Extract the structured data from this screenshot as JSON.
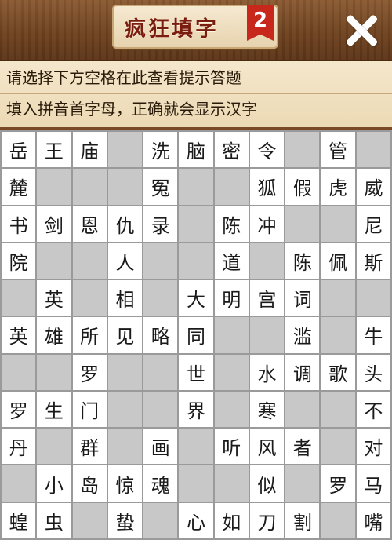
{
  "header": {
    "title": "疯狂填字",
    "badge": "2",
    "close_icon": "close-x-icon"
  },
  "hints": {
    "line1": "请选择下方空格在此查看提示答题",
    "line2": "填入拼音首字母，正确就会显示汉字"
  },
  "colors": {
    "block_cell": "#c8c8c8",
    "title_text": "#7a1d0f",
    "badge": "#c8281c"
  },
  "grid": [
    [
      "岳",
      "王",
      "庙",
      "#",
      "洗",
      "脑",
      "密",
      "令",
      "#",
      "管",
      "#"
    ],
    [
      "麓",
      "#",
      "#",
      "#",
      "冤",
      "#",
      "#",
      "狐",
      "假",
      "虎",
      "威"
    ],
    [
      "书",
      "剑",
      "恩",
      "仇",
      "录",
      "#",
      "陈",
      "冲",
      "#",
      "#",
      "尼"
    ],
    [
      "院",
      "#",
      "#",
      "人",
      "#",
      "#",
      "道",
      "#",
      "陈",
      "佩",
      "斯"
    ],
    [
      "#",
      "英",
      "#",
      "相",
      "#",
      "大",
      "明",
      "宫",
      "词",
      "#",
      "#"
    ],
    [
      "英",
      "雄",
      "所",
      "见",
      "略",
      "同",
      "#",
      "#",
      "滥",
      "#",
      "牛"
    ],
    [
      "#",
      "#",
      "罗",
      "#",
      "#",
      "世",
      "#",
      "水",
      "调",
      "歌",
      "头"
    ],
    [
      "罗",
      "生",
      "门",
      "#",
      "#",
      "界",
      "#",
      "寒",
      "#",
      "#",
      "不"
    ],
    [
      "丹",
      "#",
      "群",
      "#",
      "画",
      "#",
      "听",
      "风",
      "者",
      "#",
      "对"
    ],
    [
      "#",
      "小",
      "岛",
      "惊",
      "魂",
      "#",
      "#",
      "似",
      "#",
      "罗",
      "马"
    ],
    [
      "蝗",
      "虫",
      "#",
      "蛰",
      "#",
      "心",
      "如",
      "刀",
      "割",
      "#",
      "嘴"
    ]
  ]
}
